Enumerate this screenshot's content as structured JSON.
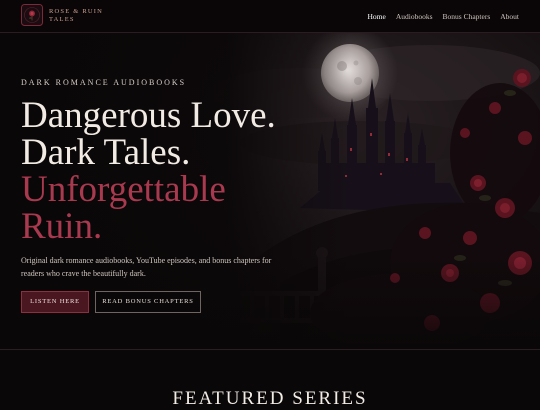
{
  "brand": {
    "line1": "ROSE & RUIN",
    "line2": "TALES"
  },
  "nav": {
    "items": [
      {
        "label": "Home",
        "active": true
      },
      {
        "label": "Audiobooks",
        "active": false
      },
      {
        "label": "Bonus Chapters",
        "active": false
      },
      {
        "label": "About",
        "active": false
      }
    ]
  },
  "hero": {
    "eyebrow": "DARK ROMANCE AUDIOBOOKS",
    "headline": {
      "line1": "Dangerous Love.",
      "line2": "Dark Tales.",
      "line3": "Unforgettable",
      "line4": "Ruin."
    },
    "description": "Original dark romance audiobooks, YouTube episodes, and bonus chapters for readers who crave the beautifully dark.",
    "primary_button": "LISTEN HERE",
    "secondary_button": "READ BONUS CHAPTERS"
  },
  "featured": {
    "title": "FEATURED SERIES"
  },
  "colors": {
    "background": "#0a0708",
    "accent": "#a8394f",
    "button_primary": "#4a1620",
    "brand_gold": "#c9a08f"
  }
}
